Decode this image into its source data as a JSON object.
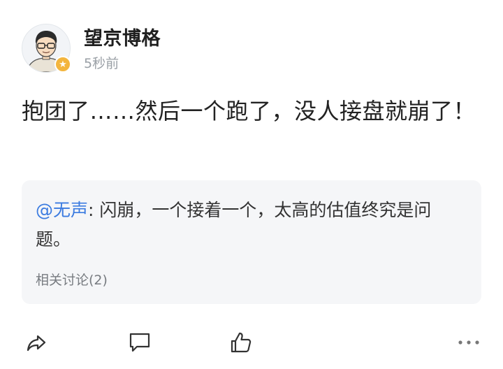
{
  "post": {
    "author": "望京博格",
    "time": "5秒前",
    "content": "抱团了……然后一个跑了，没人接盘就崩了！"
  },
  "quote": {
    "mention": "@无声",
    "separator": ": ",
    "text": "闪崩，一个接着一个，太高的估值终究是问题。",
    "related_label": "相关讨论(2)"
  },
  "actions": {
    "share_icon": "share-icon",
    "comment_icon": "comment-icon",
    "like_icon": "like-icon",
    "more_icon": "more-icon"
  },
  "colors": {
    "accent": "#3b7be0",
    "badge": "#f3b53d",
    "card_bg": "#f5f6f8",
    "muted": "#9aa0a6"
  }
}
